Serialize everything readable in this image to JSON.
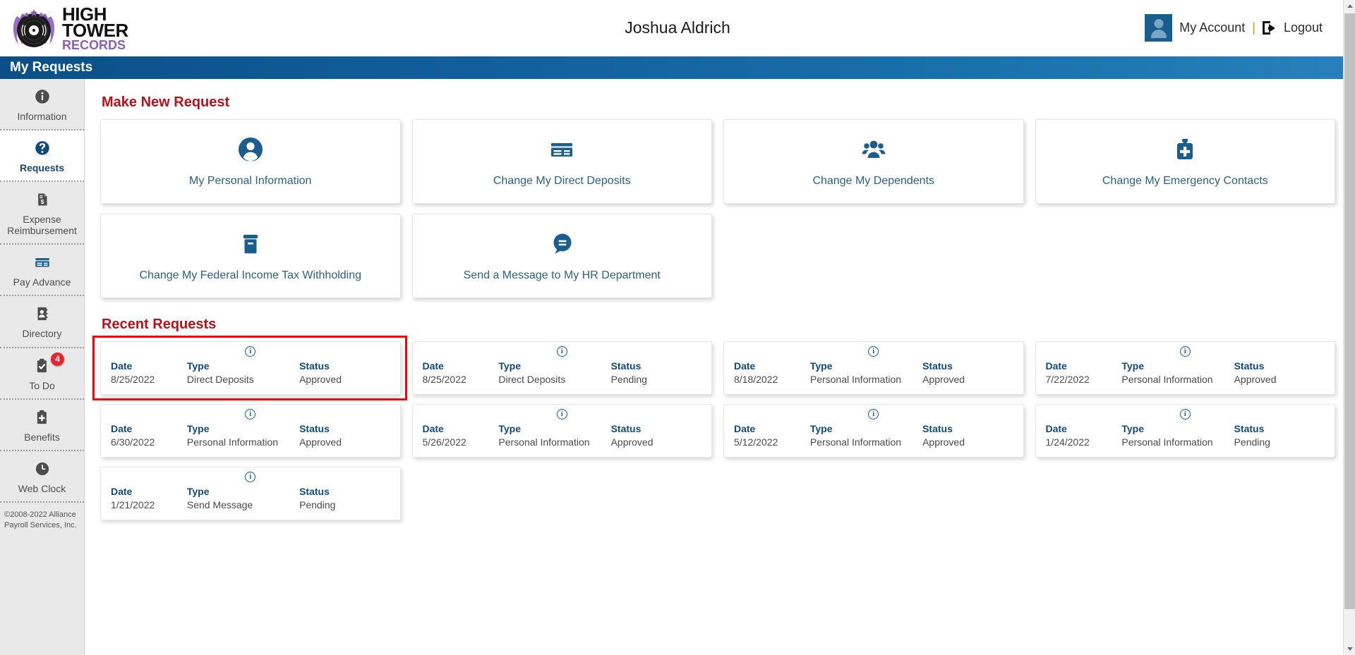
{
  "header": {
    "logo": {
      "line1": "HIGH",
      "line2": "TOWER",
      "line3": "RECORDS",
      "icon": "vinyl-record-icon"
    },
    "user_name": "Joshua Aldrich",
    "my_account_label": "My Account",
    "separator": "|",
    "logout_label": "Logout"
  },
  "banner": {
    "title": "My Requests"
  },
  "sidebar": {
    "items": [
      {
        "label": "Information",
        "icon": "info-circle-icon",
        "active": false
      },
      {
        "label": "Requests",
        "icon": "question-circle-icon",
        "active": true
      },
      {
        "label": "Expense Reimbursement",
        "icon": "document-dollar-icon",
        "active": false
      },
      {
        "label": "Pay Advance",
        "icon": "credit-card-icon",
        "active": false
      },
      {
        "label": "Directory",
        "icon": "address-book-icon",
        "active": false
      },
      {
        "label": "To Do",
        "icon": "clipboard-check-icon",
        "active": false,
        "badge": "4"
      },
      {
        "label": "Benefits",
        "icon": "medical-clipboard-icon",
        "active": false
      },
      {
        "label": "Web Clock",
        "icon": "clock-icon",
        "active": false
      }
    ],
    "copyright": "©2008-2022 Alliance Payroll Services, Inc."
  },
  "main": {
    "new_request_title": "Make New Request",
    "recent_requests_title": "Recent Requests",
    "new_requests": [
      {
        "label": "My Personal Information",
        "icon": "person-circle-icon"
      },
      {
        "label": "Change My Direct Deposits",
        "icon": "credit-card-icon"
      },
      {
        "label": "Change My Dependents",
        "icon": "people-group-icon"
      },
      {
        "label": "Change My Emergency Contacts",
        "icon": "medical-bag-icon"
      },
      {
        "label": "Change My Federal Income Tax Withholding",
        "icon": "archive-box-icon"
      },
      {
        "label": "Send a Message to My HR Department",
        "icon": "speech-bubble-icon"
      }
    ],
    "recent_columns": {
      "date": "Date",
      "type": "Type",
      "status": "Status"
    },
    "recent_requests": [
      {
        "date": "8/25/2022",
        "type": "Direct Deposits",
        "status": "Approved",
        "highlighted": true
      },
      {
        "date": "8/25/2022",
        "type": "Direct Deposits",
        "status": "Pending",
        "highlighted": false
      },
      {
        "date": "8/18/2022",
        "type": "Personal Information",
        "status": "Approved",
        "highlighted": false
      },
      {
        "date": "7/22/2022",
        "type": "Personal Information",
        "status": "Approved",
        "highlighted": false
      },
      {
        "date": "6/30/2022",
        "type": "Personal Information",
        "status": "Approved",
        "highlighted": false
      },
      {
        "date": "5/26/2022",
        "type": "Personal Information",
        "status": "Approved",
        "highlighted": false
      },
      {
        "date": "5/12/2022",
        "type": "Personal Information",
        "status": "Approved",
        "highlighted": false
      },
      {
        "date": "1/24/2022",
        "type": "Personal Information",
        "status": "Pending",
        "highlighted": false
      },
      {
        "date": "1/21/2022",
        "type": "Send Message",
        "status": "Pending",
        "highlighted": false
      }
    ]
  },
  "colors": {
    "banner_start": "#0b4f86",
    "banner_end": "#2980bc",
    "section_title": "#b5121b",
    "icon_blue": "#1b5e8e",
    "highlight_red": "#ff0000",
    "badge_red": "#e8242c",
    "logo_purple": "#8d5fb5"
  }
}
